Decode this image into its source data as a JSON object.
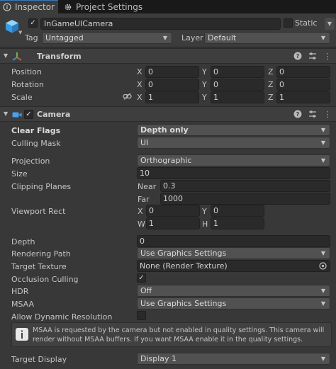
{
  "tabs": [
    {
      "label": "Inspector"
    },
    {
      "label": "Project Settings"
    }
  ],
  "object": {
    "name": "InGameUICamera",
    "active": true,
    "static_label": "Static",
    "static": false,
    "tag_label": "Tag",
    "tag_value": "Untagged",
    "layer_label": "Layer",
    "layer_value": "Default"
  },
  "transform": {
    "title": "Transform",
    "position": {
      "label": "Position",
      "x": "0",
      "y": "0",
      "z": "0"
    },
    "rotation": {
      "label": "Rotation",
      "x": "0",
      "y": "0",
      "z": "0"
    },
    "scale": {
      "label": "Scale",
      "x": "1",
      "y": "1",
      "z": "1"
    },
    "axes": {
      "x": "X",
      "y": "Y",
      "z": "Z"
    }
  },
  "camera": {
    "title": "Camera",
    "enabled": true,
    "clear_flags": {
      "label": "Clear Flags",
      "value": "Depth only"
    },
    "culling_mask": {
      "label": "Culling Mask",
      "value": "UI"
    },
    "projection": {
      "label": "Projection",
      "value": "Orthographic"
    },
    "size": {
      "label": "Size",
      "value": "10"
    },
    "clipping": {
      "label": "Clipping Planes",
      "near_label": "Near",
      "near": "0.3",
      "far_label": "Far",
      "far": "1000"
    },
    "viewport": {
      "label": "Viewport Rect",
      "x_label": "X",
      "x": "0",
      "y_label": "Y",
      "y": "0",
      "w_label": "W",
      "w": "1",
      "h_label": "H",
      "h": "1"
    },
    "depth": {
      "label": "Depth",
      "value": "0"
    },
    "rendering_path": {
      "label": "Rendering Path",
      "value": "Use Graphics Settings"
    },
    "target_texture": {
      "label": "Target Texture",
      "value": "None (Render Texture)"
    },
    "occlusion_culling": {
      "label": "Occlusion Culling",
      "value": true
    },
    "hdr": {
      "label": "HDR",
      "value": "Off"
    },
    "msaa": {
      "label": "MSAA",
      "value": "Use Graphics Settings"
    },
    "dynamic_resolution": {
      "label": "Allow Dynamic Resolution",
      "value": false
    },
    "msaa_warning": "MSAA is requested by the camera but not enabled in quality settings. This camera will render without MSAA buffers. If you want MSAA enable it in the quality settings.",
    "target_display": {
      "label": "Target Display",
      "value": "Display 1"
    }
  },
  "icons": {
    "inspector_tab": "info-icon",
    "project_settings_tab": "gear-icon",
    "game_object": "cube-icon",
    "transform": "transform-axes-icon",
    "camera": "camera-icon",
    "help": "help-icon",
    "presets": "presets-icon",
    "more": "more-icon",
    "constrain": "link-icon",
    "warning": "info-icon"
  },
  "colors": {
    "background": "#383838",
    "tab_accent": "#3a79bb",
    "transform_icon_red": "#e0573f",
    "transform_icon_green": "#7fbf3f",
    "transform_icon_blue": "#3f8fe0",
    "camera_icon": "#4aa0ea",
    "cube_icon": "#4aa8e8"
  }
}
